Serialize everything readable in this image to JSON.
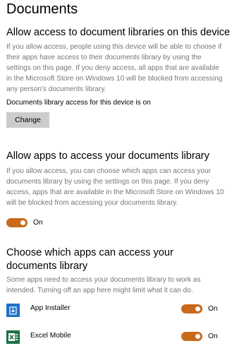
{
  "page": {
    "title": "Documents"
  },
  "device_section": {
    "heading": "Allow access to document libraries on this device",
    "description": "If you allow access, people using this device will be able to choose if their apps have access to their documents library by using the settings on this page. If you deny access, all apps that are available in the Microsoft Store on Windows 10 will be blocked from accessing any person's documents library.",
    "status": "Documents library access for this device is on",
    "change_label": "Change"
  },
  "apps_section": {
    "heading": "Allow apps to access your documents library",
    "description": "If you allow access, you can choose which apps can access your documents library by using the settings on this page. If you deny access, apps that are available in the Microsoft Store on Windows 10 will be blocked from accessing your documents library.",
    "toggle": {
      "state_label": "On",
      "is_on": true
    }
  },
  "choose_section": {
    "heading": "Choose which apps can access your documents library",
    "description": "Some apps need to access your documents library to work as intended. Turning off an app here might limit what it can do.",
    "apps": [
      {
        "name": "App Installer",
        "icon": "app-installer-icon",
        "state_label": "On",
        "is_on": true
      },
      {
        "name": "Excel Mobile",
        "icon": "excel-icon",
        "state_label": "On",
        "is_on": true
      }
    ]
  },
  "colors": {
    "accent": "#c96a1b",
    "app_installer_blue": "#1f6fc6",
    "excel_green": "#1e7145",
    "description_gray": "#767676",
    "button_gray": "#cccccc"
  }
}
